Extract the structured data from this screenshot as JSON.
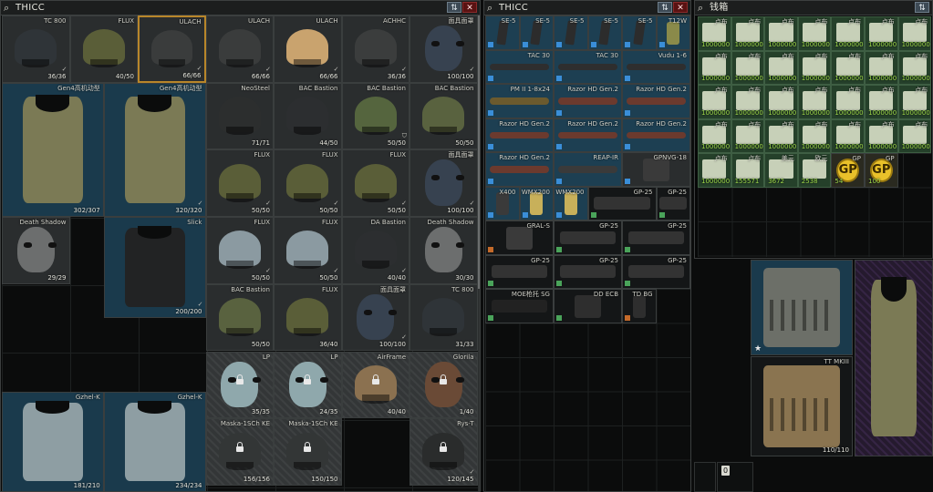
{
  "colors": {
    "item_grey": "#2a2d2e",
    "item_blue": "#1a3a4c",
    "item_dark": "#141617",
    "item_money": "#25402a",
    "item_hatch": "#333637",
    "item_purple": "#251a2e",
    "selected_border": "#b8862a",
    "tag_blue": "#3a8ed8",
    "tag_green": "#4aa35a",
    "tag_orange": "#c46a2a",
    "gp_coin": "#e9c12a",
    "close_red": "#5a1212"
  },
  "windows": [
    {
      "id": "win-left",
      "title": "THICC",
      "icons": {
        "search": "search-icon",
        "sort": "sort-icon",
        "close": "close-icon"
      },
      "sort_glyph": "⇅",
      "close_glyph": "✕",
      "search_glyph": "⌕"
    },
    {
      "id": "win-mid",
      "title": "THICC",
      "icons": {
        "search": "search-icon",
        "sort": "sort-icon",
        "close": "close-icon"
      },
      "sort_glyph": "⇅",
      "close_glyph": "✕",
      "search_glyph": "⌕"
    },
    {
      "id": "win-right",
      "title": "钱箱",
      "icons": {
        "search": "search-icon",
        "sort": "sort-icon"
      },
      "sort_glyph": "⇅",
      "search_glyph": "⌕"
    }
  ],
  "left_items": [
    {
      "name": "TC 800",
      "dur": "36/36",
      "kind": "helmet",
      "bg": "bg-grey",
      "color": "#2f3438",
      "mk": "✓"
    },
    {
      "name": "FLUX",
      "dur": "40/50",
      "kind": "helmet",
      "bg": "bg-grey",
      "color": "#5a5e38",
      "mk": ""
    },
    {
      "name": "ULACH",
      "dur": "66/66",
      "kind": "helmet",
      "bg": "bg-orange-fill",
      "color": "#3a3c3c",
      "mk": "✓"
    },
    {
      "name": "ULACH",
      "dur": "66/66",
      "kind": "helmet",
      "bg": "bg-grey",
      "color": "#3a3c3c",
      "mk": "✓"
    },
    {
      "name": "ULACH",
      "dur": "66/66",
      "kind": "helmet",
      "bg": "bg-grey",
      "color": "#c9a36e",
      "mk": "✓"
    },
    {
      "name": "ACHHC",
      "dur": "36/36",
      "kind": "helmet",
      "bg": "bg-grey",
      "color": "#3b3d3d",
      "mk": "✓"
    },
    {
      "name": "面具面罩",
      "dur": "100/100",
      "kind": "mask",
      "bg": "bg-grey",
      "color": "#374250",
      "mk": "✓"
    },
    {
      "name": "Gen4高机动型",
      "dur": "302/307",
      "kind": "vest",
      "bg": "bg-blue",
      "color": "#7b7a55",
      "mk": ""
    },
    {
      "name": "Gen4高机动型",
      "dur": "320/320",
      "kind": "vest",
      "bg": "bg-blue",
      "color": "#7b7a55",
      "mk": "✓"
    },
    {
      "name": "NeoSteel",
      "dur": "71/71",
      "kind": "helmet",
      "bg": "bg-grey",
      "color": "#2c2e2e",
      "mk": ""
    },
    {
      "name": "BAC Bastion",
      "dur": "44/50",
      "kind": "helmet",
      "bg": "bg-grey",
      "color": "#2c2e30",
      "mk": ""
    },
    {
      "name": "BAC Bastion",
      "dur": "50/50",
      "kind": "helmet",
      "bg": "bg-grey",
      "color": "#55653e",
      "mk": "⛉"
    },
    {
      "name": "BAC Bastion",
      "dur": "50/50",
      "kind": "helmet",
      "bg": "bg-grey",
      "color": "#59623f",
      "mk": ""
    },
    {
      "name": "FLUX",
      "dur": "50/50",
      "kind": "helmet",
      "bg": "bg-grey",
      "color": "#5a5e38",
      "mk": "✓"
    },
    {
      "name": "FLUX",
      "dur": "50/50",
      "kind": "helmet",
      "bg": "bg-grey",
      "color": "#5a5e38",
      "mk": "✓"
    },
    {
      "name": "FLUX",
      "dur": "50/50",
      "kind": "helmet",
      "bg": "bg-grey",
      "color": "#5a5e38",
      "mk": "✓"
    },
    {
      "name": "面具面罩",
      "dur": "100/100",
      "kind": "mask",
      "bg": "bg-grey",
      "color": "#374250",
      "mk": "✓"
    },
    {
      "name": "Death Shadow",
      "dur": "29/29",
      "kind": "mask",
      "bg": "bg-grey",
      "color": "#6c6e6e",
      "mk": ""
    },
    {
      "name": "Slick",
      "dur": "200/200",
      "kind": "vest",
      "bg": "bg-blue",
      "color": "#222324",
      "mk": "✓"
    },
    {
      "name": "FLUX",
      "dur": "50/50",
      "kind": "helmet",
      "bg": "bg-grey",
      "color": "#8b9aa1",
      "mk": "✓"
    },
    {
      "name": "FLUX",
      "dur": "50/50",
      "kind": "helmet",
      "bg": "bg-grey",
      "color": "#8b9aa1",
      "mk": "✓"
    },
    {
      "name": "DA Bastion",
      "dur": "40/40",
      "kind": "helmet",
      "bg": "bg-grey",
      "color": "#2c2e30",
      "mk": "✓"
    },
    {
      "name": "Death Shadow",
      "dur": "30/30",
      "kind": "mask",
      "bg": "bg-grey",
      "color": "#6c6e6e",
      "mk": ""
    },
    {
      "name": "BAC Bastion",
      "dur": "50/50",
      "kind": "helmet",
      "bg": "bg-grey",
      "color": "#59623f",
      "mk": ""
    },
    {
      "name": "FLUX",
      "dur": "36/40",
      "kind": "helmet",
      "bg": "bg-grey",
      "color": "#5a5e38",
      "mk": ""
    },
    {
      "name": "面具面罩",
      "dur": "100/100",
      "kind": "mask",
      "bg": "bg-grey",
      "color": "#374250",
      "mk": "✓"
    },
    {
      "name": "TC 800",
      "dur": "31/33",
      "kind": "helmet",
      "bg": "bg-grey",
      "color": "#2f3438",
      "mk": ""
    },
    {
      "name": "LP",
      "dur": "35/35",
      "kind": "mask",
      "bg": "bg-hatch",
      "color": "#8fa8ac",
      "mk": "",
      "lock": true
    },
    {
      "name": "LP",
      "dur": "24/35",
      "kind": "mask",
      "bg": "bg-hatch",
      "color": "#8fa8ac",
      "mk": "",
      "lock": true
    },
    {
      "name": "AirFrame",
      "dur": "40/40",
      "kind": "helmet",
      "bg": "bg-hatch",
      "color": "#8b7150",
      "mk": "",
      "lock": true
    },
    {
      "name": "Glorila",
      "dur": "1/40",
      "kind": "mask",
      "bg": "bg-hatch",
      "color": "#6a4a36",
      "mk": "",
      "lock": true
    },
    {
      "name": "Gzhel-K",
      "dur": "181/210",
      "kind": "vest",
      "bg": "bg-blue",
      "color": "#8e9ea3",
      "mk": ""
    },
    {
      "name": "Gzhel-K",
      "dur": "234/234",
      "kind": "vest",
      "bg": "bg-blue",
      "color": "#8e9ea3",
      "mk": ""
    },
    {
      "name": "Maska-1SCh KE",
      "dur": "156/156",
      "kind": "helmet",
      "bg": "bg-hatch",
      "color": "#333636",
      "mk": "",
      "lock": true
    },
    {
      "name": "Maska-1SCh KE",
      "dur": "150/150",
      "kind": "helmet",
      "bg": "bg-hatch",
      "color": "#333636",
      "mk": "",
      "lock": true
    },
    {
      "name": "Rys-T",
      "dur": "120/145",
      "kind": "helmet",
      "bg": "bg-hatch",
      "color": "#2a2c2c",
      "mk": "✓",
      "lock": true
    }
  ],
  "mid_items": [
    {
      "name": "SE-5",
      "cnt": "",
      "kind": "mag",
      "bg": "bg-blue2",
      "color": "#2c2c2c",
      "tag": "blue"
    },
    {
      "name": "SE-5",
      "cnt": "",
      "kind": "mag",
      "bg": "bg-blue2",
      "color": "#2c2c2c",
      "tag": "blue"
    },
    {
      "name": "SE-5",
      "cnt": "",
      "kind": "mag",
      "bg": "bg-blue2",
      "color": "#2c2c2c",
      "tag": "blue"
    },
    {
      "name": "SE-5",
      "cnt": "",
      "kind": "mag",
      "bg": "bg-blue2",
      "color": "#2c2c2c",
      "tag": "blue"
    },
    {
      "name": "SE-5",
      "cnt": "",
      "kind": "mag",
      "bg": "bg-blue2",
      "color": "#2c2c2c",
      "tag": "blue"
    },
    {
      "name": "T12W",
      "cnt": "",
      "kind": "grip",
      "bg": "bg-blue2",
      "color": "#8a8a4a",
      "tag": "blue"
    },
    {
      "name": "TAC 30",
      "cnt": "",
      "kind": "scope",
      "bg": "bg-blue2",
      "color": "#2e2e2e",
      "tag": "blue"
    },
    {
      "name": "TAC 30",
      "cnt": "",
      "kind": "scope",
      "bg": "bg-blue2",
      "color": "#2e2e2e",
      "tag": "blue"
    },
    {
      "name": "Vudu 1-6",
      "cnt": "",
      "kind": "scope",
      "bg": "bg-blue2",
      "color": "#2e2e2e",
      "tag": "blue"
    },
    {
      "name": "PM II 1-8x24",
      "cnt": "",
      "kind": "scope",
      "bg": "bg-blue2",
      "color": "#6b5a2e",
      "tag": "blue"
    },
    {
      "name": "Razor HD Gen.2",
      "cnt": "",
      "kind": "scope",
      "bg": "bg-blue2",
      "color": "#6b3a2e",
      "tag": "blue"
    },
    {
      "name": "Razor HD Gen.2",
      "cnt": "",
      "kind": "scope",
      "bg": "bg-blue2",
      "color": "#6b3a2e",
      "tag": "blue"
    },
    {
      "name": "Razor HD Gen.2",
      "cnt": "",
      "kind": "scope",
      "bg": "bg-blue2",
      "color": "#6b3a2e",
      "tag": "blue"
    },
    {
      "name": "Razor HD Gen.2",
      "cnt": "",
      "kind": "scope",
      "bg": "bg-blue2",
      "color": "#6b3a2e",
      "tag": "blue"
    },
    {
      "name": "Razor HD Gen.2",
      "cnt": "",
      "kind": "scope",
      "bg": "bg-blue2",
      "color": "#6b3a2e",
      "tag": "blue"
    },
    {
      "name": "Razor HD Gen.2",
      "cnt": "",
      "kind": "scope",
      "bg": "bg-blue2",
      "color": "#6b3a2e",
      "tag": "blue"
    },
    {
      "name": "REAP-IR",
      "cnt": "",
      "kind": "scope",
      "bg": "bg-blue2",
      "color": "#3a3a3a",
      "tag": "blue"
    },
    {
      "name": "GPNVG-18",
      "cnt": "",
      "kind": "grip",
      "bg": "bg-grey",
      "color": "#3a3a3a",
      "tag": "blue"
    },
    {
      "name": "X400",
      "cnt": "",
      "kind": "grip",
      "bg": "bg-blue2",
      "color": "#3a3a3a",
      "tag": "blue"
    },
    {
      "name": "WMX200",
      "cnt": "",
      "kind": "grip",
      "bg": "bg-blue2",
      "color": "#c8b05a",
      "tag": "blue"
    },
    {
      "name": "WMX200",
      "cnt": "",
      "kind": "grip",
      "bg": "bg-blue2",
      "color": "#c8b05a",
      "tag": "blue"
    },
    {
      "name": "GP-25",
      "cnt": "",
      "kind": "gl",
      "bg": "bg-dark",
      "color": "#333",
      "tag": "green"
    },
    {
      "name": "GP-25",
      "cnt": "",
      "kind": "gl",
      "bg": "bg-dark",
      "color": "#333",
      "tag": "green"
    },
    {
      "name": "GRAL-S",
      "cnt": "",
      "kind": "grip",
      "bg": "bg-dark",
      "color": "#3a3a3a",
      "tag": "orange"
    },
    {
      "name": "GP-25",
      "cnt": "",
      "kind": "gl",
      "bg": "bg-dark",
      "color": "#333",
      "tag": "green"
    },
    {
      "name": "GP-25",
      "cnt": "",
      "kind": "gl",
      "bg": "bg-dark",
      "color": "#333",
      "tag": "green"
    },
    {
      "name": "GP-25",
      "cnt": "",
      "kind": "gl",
      "bg": "bg-dark",
      "color": "#333",
      "tag": "green"
    },
    {
      "name": "GP-25",
      "cnt": "",
      "kind": "gl",
      "bg": "bg-dark",
      "color": "#333",
      "tag": "green"
    },
    {
      "name": "GP-25",
      "cnt": "",
      "kind": "gl",
      "bg": "bg-dark",
      "color": "#333",
      "tag": "green"
    },
    {
      "name": "MOE枪托 SG",
      "cnt": "",
      "kind": "gl",
      "bg": "bg-dark",
      "color": "#222",
      "tag": "green"
    },
    {
      "name": "DD ECB",
      "cnt": "",
      "kind": "grip",
      "bg": "bg-dark",
      "color": "#2e2e2e",
      "tag": "green"
    },
    {
      "name": "TD BG",
      "cnt": "",
      "kind": "grip",
      "bg": "bg-dark",
      "color": "#2e2e2e",
      "tag": "orange"
    }
  ],
  "right_items": [
    {
      "name": "卢布",
      "cnt": "1000000",
      "kind": "note"
    },
    {
      "name": "卢布",
      "cnt": "1000000",
      "kind": "note"
    },
    {
      "name": "卢布",
      "cnt": "1000000",
      "kind": "note"
    },
    {
      "name": "卢布",
      "cnt": "1000000",
      "kind": "note"
    },
    {
      "name": "卢布",
      "cnt": "1000000",
      "kind": "note"
    },
    {
      "name": "卢布",
      "cnt": "1000000",
      "kind": "note"
    },
    {
      "name": "卢布",
      "cnt": "1000000",
      "kind": "note"
    },
    {
      "name": "卢布",
      "cnt": "1000000",
      "kind": "note"
    },
    {
      "name": "卢布",
      "cnt": "1000000",
      "kind": "note"
    },
    {
      "name": "卢布",
      "cnt": "1000000",
      "kind": "note"
    },
    {
      "name": "卢布",
      "cnt": "1000000",
      "kind": "note"
    },
    {
      "name": "卢布",
      "cnt": "1000000",
      "kind": "note"
    },
    {
      "name": "卢布",
      "cnt": "1000000",
      "kind": "note"
    },
    {
      "name": "卢布",
      "cnt": "1000000",
      "kind": "note"
    },
    {
      "name": "卢布",
      "cnt": "1000000",
      "kind": "note"
    },
    {
      "name": "卢布",
      "cnt": "1000000",
      "kind": "note"
    },
    {
      "name": "卢布",
      "cnt": "1000000",
      "kind": "note"
    },
    {
      "name": "卢布",
      "cnt": "1000000",
      "kind": "note"
    },
    {
      "name": "卢布",
      "cnt": "1000000",
      "kind": "note"
    },
    {
      "name": "卢布",
      "cnt": "1000000",
      "kind": "note"
    },
    {
      "name": "卢布",
      "cnt": "1000000",
      "kind": "note"
    },
    {
      "name": "卢布",
      "cnt": "1000000",
      "kind": "note"
    },
    {
      "name": "卢布",
      "cnt": "1000000",
      "kind": "note"
    },
    {
      "name": "卢布",
      "cnt": "1000000",
      "kind": "note"
    },
    {
      "name": "卢布",
      "cnt": "1000000",
      "kind": "note"
    },
    {
      "name": "卢布",
      "cnt": "1000000",
      "kind": "note"
    },
    {
      "name": "卢布",
      "cnt": "1000000",
      "kind": "note"
    },
    {
      "name": "卢布",
      "cnt": "1000000",
      "kind": "note"
    },
    {
      "name": "卢布",
      "cnt": "1000000",
      "kind": "note"
    },
    {
      "name": "卢布",
      "cnt": "155571",
      "kind": "note"
    },
    {
      "name": "美元",
      "cnt": "3672",
      "kind": "note"
    },
    {
      "name": "欧元",
      "cnt": "2538",
      "kind": "note"
    },
    {
      "name": "GP",
      "cnt": "54",
      "kind": "coin"
    },
    {
      "name": "GP",
      "cnt": "100",
      "kind": "coin"
    }
  ],
  "coin_text": "GP",
  "bottom_items": [
    {
      "name": "",
      "dur": "",
      "kind": "rig",
      "color": "#6c6f68",
      "star": "★"
    },
    {
      "name": "TT MKIII",
      "dur": "110/110",
      "kind": "rig",
      "color": "#8a7450"
    }
  ],
  "bottom_badge": "0"
}
